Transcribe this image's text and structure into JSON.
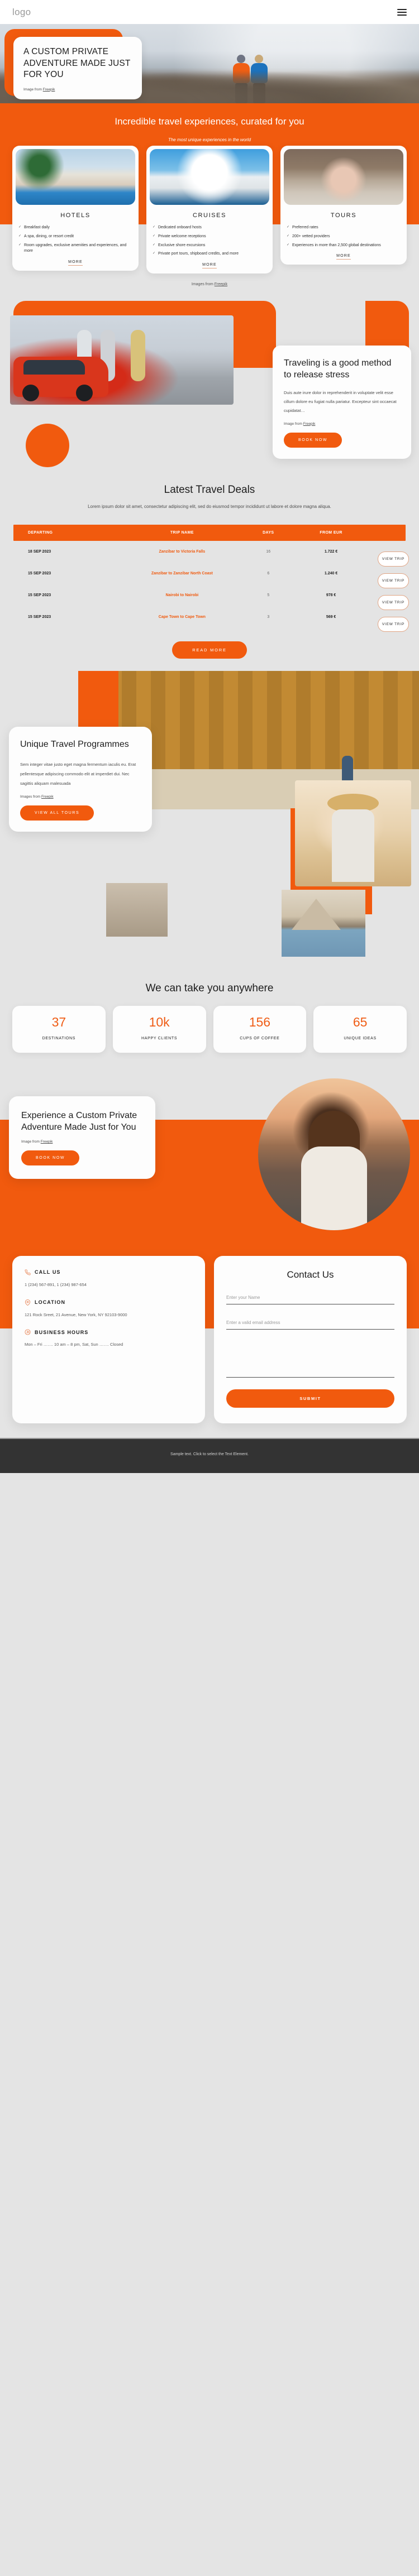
{
  "header": {
    "logo": "logo",
    "menu_icon": "hamburger-icon"
  },
  "hero": {
    "title": "A CUSTOM PRIVATE ADVENTURE MADE JUST FOR YOU",
    "credit_prefix": "Image from ",
    "credit_link": "Freepik"
  },
  "services": {
    "title": "Incredible travel experiences, curated for you",
    "subtitle": "The most unique experiences in the world",
    "credit_prefix": "Images from ",
    "credit_link": "Freepik",
    "cards": [
      {
        "image": "hotel-pool-photo",
        "title": "HOTELS",
        "items": [
          "Breakfast daily",
          "A spa, dining, or resort credit",
          "Room upgrades, exclusive amenities and experiences, and more"
        ],
        "more_label": "MORE"
      },
      {
        "image": "cruise-ship-photo",
        "title": "CRUISES",
        "items": [
          "Dedicated onboard hosts",
          "Private welcome receptions",
          "Exclusive shore excursions",
          "Private port tours, shipboard credits, and more"
        ],
        "more_label": "MORE"
      },
      {
        "image": "tour-couple-photo",
        "title": "TOURS",
        "items": [
          "Preferred rates",
          "200+ vetted providers",
          "Experiences in more than 2,500 global destinations"
        ],
        "more_label": "MORE"
      }
    ]
  },
  "stress": {
    "title": "Traveling is a good method to release stress",
    "body": "Duis aute irure dolor in reprehenderit in voluptate velit esse cillum dolore eu fugiat nulla pariatur. Excepteur sint occaecat cupidatat…",
    "credit_prefix": "Image from ",
    "credit_link": "Freepik",
    "button": "BOOK NOW"
  },
  "deals": {
    "title": "Latest Travel Deals",
    "subtitle": "Lorem ipsum dolor sit amet, consectetur adipiscing elit, sed do eiusmod tempor incididunt ut labore et dolore magna aliqua.",
    "columns": [
      "DEPARTING",
      "TRIP NAME",
      "DAYS",
      "FROM EUR"
    ],
    "action_label": "VIEW TRIP",
    "rows": [
      {
        "departing": "18 SEP 2023",
        "trip": "Zanzibar to Victoria Falls",
        "days": "16",
        "price": "1.722 €"
      },
      {
        "departing": "15 SEP 2023",
        "trip": "Zanzibar to Zanzibar North Coast",
        "days": "6",
        "price": "1.240 €"
      },
      {
        "departing": "15 SEP 2023",
        "trip": "Nairobi to Nairobi",
        "days": "5",
        "price": "978 €"
      },
      {
        "departing": "15 SEP 2023",
        "trip": "Cape Town to Cape Town",
        "days": "3",
        "price": "569 €"
      }
    ],
    "read_more": "READ MORE"
  },
  "programmes": {
    "title": "Unique Travel Programmes",
    "body": "Sem integer vitae justo eget magna fermentum iaculis eu. Erat pellentesque adipiscing commodo elit at imperdiet dui. Nec sagittis aliquam malesuada",
    "credit_prefix": "Images from ",
    "credit_link": "Freepik",
    "button": "VIEW ALL TOURS"
  },
  "stats": {
    "title": "We can take you anywhere",
    "items": [
      {
        "number": "37",
        "label": "DESTINATIONS"
      },
      {
        "number": "10k",
        "label": "HAPPY CLIENTS"
      },
      {
        "number": "156",
        "label": "CUPS OF COFFEE"
      },
      {
        "number": "65",
        "label": "UNIQUE IDEAS"
      }
    ]
  },
  "experience": {
    "title": "Experience a Custom Private Adventure Made Just for You",
    "credit_prefix": "Image from ",
    "credit_link": "Freepik",
    "button": "BOOK NOW"
  },
  "contact": {
    "info": [
      {
        "icon": "phone-icon",
        "title": "CALL US",
        "value": "1 (234) 567-891, 1 (234) 987-654"
      },
      {
        "icon": "location-icon",
        "title": "LOCATION",
        "value": "121 Rock Sreet, 21 Avenue, New York, NY 92103-9000"
      },
      {
        "icon": "clock-24-icon",
        "title": "BUSINESS HOURS",
        "value": "Mon – Fri ……. 10 am – 8 pm, Sat, Sun ……. Closed"
      }
    ],
    "form": {
      "title": "Contact Us",
      "name_placeholder": "Enter your Name",
      "email_placeholder": "Enter a valid email address",
      "message_placeholder": "",
      "submit_label": "SUBMIT"
    }
  },
  "footer": {
    "text": "Sample text. Click to select the Text Element."
  },
  "colors": {
    "accent": "#f15a0e",
    "page_bg": "#e4e4e4",
    "footer_bg": "#333333"
  }
}
